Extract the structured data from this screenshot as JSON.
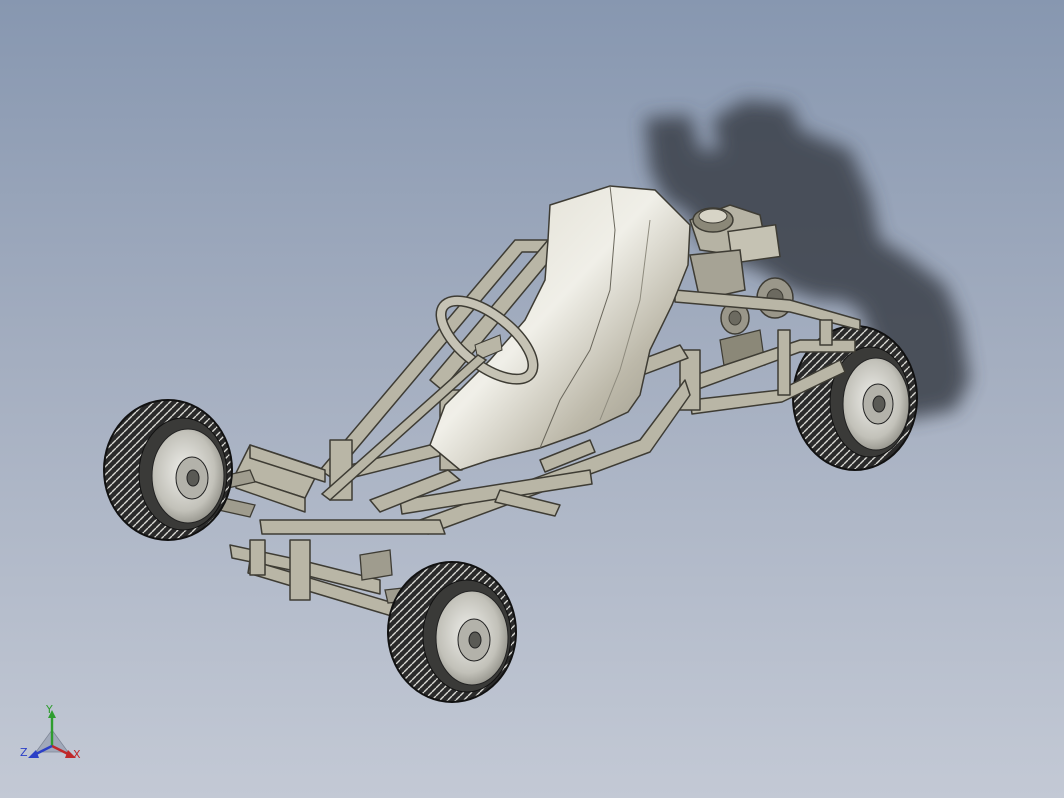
{
  "viewport": {
    "background_top": "#8797b0",
    "background_bottom": "#c3c9d5",
    "model": "go-kart-assembly",
    "shading": "shaded-with-edges"
  },
  "triad": {
    "x_label": "X",
    "y_label": "Y",
    "z_label": "Z",
    "x_color": "#c0282a",
    "y_color": "#2f9d2f",
    "z_color": "#2b3fc7"
  },
  "colors": {
    "frame_tube": "#b9b6a6",
    "frame_edge": "#3e3c34",
    "seat": "#cfccbf",
    "tire": "#2a2a2a",
    "rim": "#c8c7c0",
    "shadow": "#3b3f48"
  }
}
